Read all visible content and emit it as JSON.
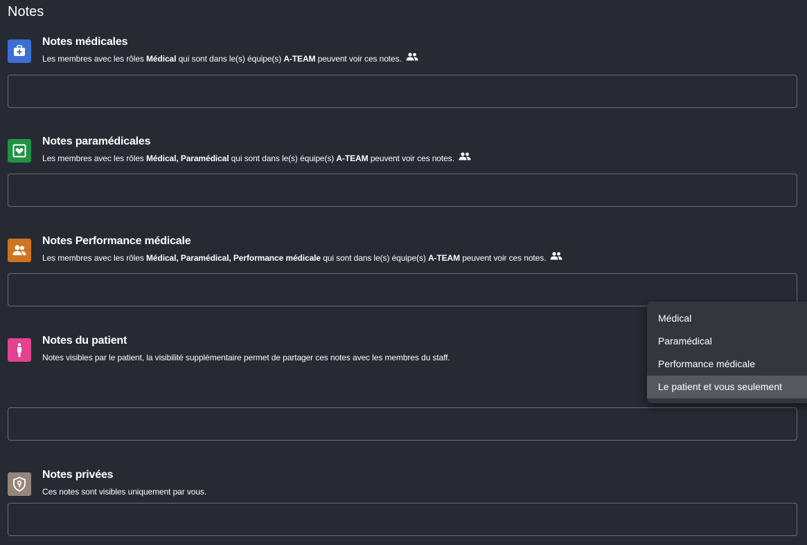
{
  "page": {
    "title": "Notes"
  },
  "sections": [
    {
      "title": "Notes médicales",
      "icon": "medical-kit-icon",
      "color": "#3b6fd4",
      "desc": {
        "prefix": "Les membres avec les rôles",
        "roles": "Médical",
        "middle": "qui sont dans le(s) équipe(s)",
        "team": "A-TEAM",
        "suffix": "peuvent voir ces notes."
      },
      "input": {
        "value": ""
      }
    },
    {
      "title": "Notes paramédicales",
      "icon": "heart-icon",
      "color": "#1f9244",
      "desc": {
        "prefix": "Les membres avec les rôles",
        "roles": "Médical, Paramédical",
        "middle": "qui sont dans le(s) équipe(s)",
        "team": "A-TEAM",
        "suffix": "peuvent voir ces notes."
      },
      "input": {
        "value": ""
      }
    },
    {
      "title": "Notes Performance médicale",
      "icon": "group-icon",
      "color": "#d1741f",
      "desc": {
        "prefix": "Les membres avec les rôles",
        "roles": "Médical, Paramédical, Performance médicale",
        "middle": "qui sont dans le(s) équipe(s)",
        "team": "A-TEAM",
        "suffix": "peuvent voir ces notes."
      },
      "input": {
        "value": ""
      }
    },
    {
      "title": "Notes du patient",
      "icon": "person-icon",
      "color": "#e5428f",
      "desc": {
        "text": "Notes visibles par le patient, la visibilité supplémentaire permet de partager ces notes avec les membres du staff."
      },
      "input": {
        "value": ""
      }
    },
    {
      "title": "Notes privées",
      "icon": "shield-lock-icon",
      "color": "#96857a",
      "desc": {
        "text": "Ces notes sont visibles uniquement par vous."
      },
      "input": {
        "value": ""
      }
    }
  ],
  "visibility_menu": {
    "items": [
      "Médical",
      "Paramédical",
      "Performance médicale",
      "Le patient et vous seulement"
    ],
    "selected": "Le patient et vous seulement"
  },
  "colors": {
    "background": "#262a33",
    "border": "#6b6f78",
    "menu_background": "#33363d",
    "menu_selected": "#55585f"
  }
}
